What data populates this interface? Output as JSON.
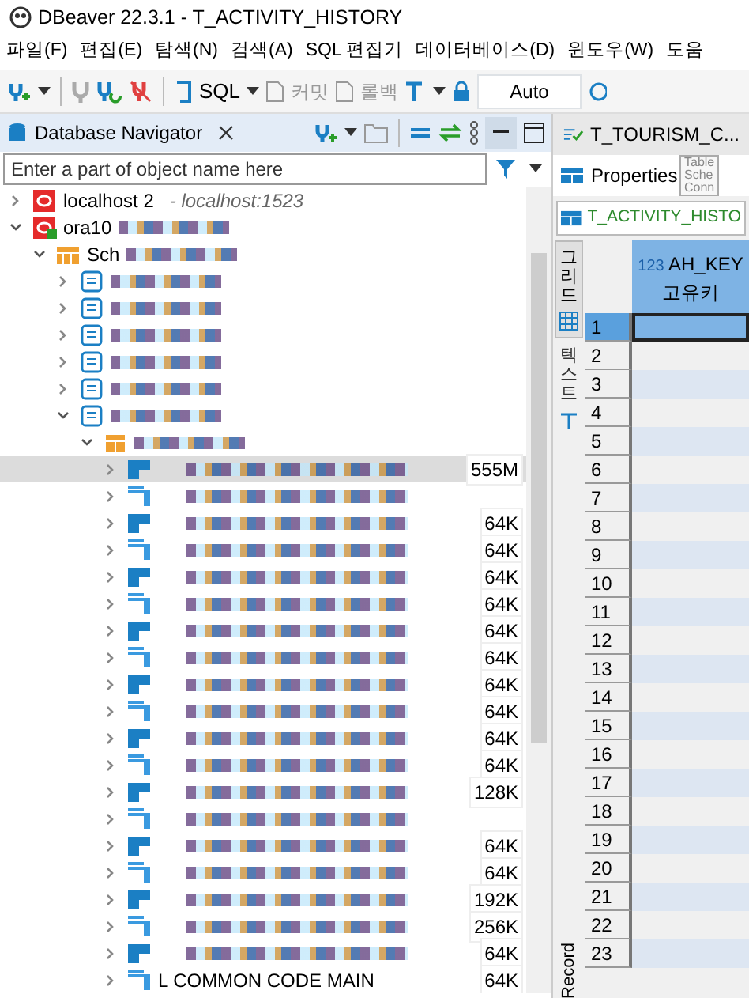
{
  "window": {
    "title": "DBeaver 22.3.1 - T_ACTIVITY_HISTORY"
  },
  "menu": [
    "파일(F)",
    "편집(E)",
    "탐색(N)",
    "검색(A)",
    "SQL 편집기",
    "데이터베이스(D)",
    "윈도우(W)",
    "도움"
  ],
  "toolbar": {
    "sql": "SQL",
    "commit": {
      "label": "커밋",
      "disabled": true
    },
    "rollback": {
      "label": "롤백",
      "disabled": true
    },
    "mode": "Auto"
  },
  "navigator": {
    "title": "Database Navigator",
    "filter": {
      "placeholder": "Enter a part of object name here"
    },
    "tree": [
      {
        "kind": "connection",
        "label": "localhost 2",
        "detail": "- localhost:1523",
        "expanded": false,
        "connected": false
      },
      {
        "kind": "connection",
        "label": "ora10",
        "obscured": true,
        "expanded": true,
        "connected": true,
        "children": [
          {
            "kind": "schemas",
            "label": "Sch",
            "obscured": true,
            "expanded": true,
            "children": [
              {
                "kind": "schema",
                "obscured": true,
                "expanded": false
              },
              {
                "kind": "schema",
                "obscured": true,
                "expanded": false
              },
              {
                "kind": "schema",
                "obscured": true,
                "expanded": false
              },
              {
                "kind": "schema",
                "obscured": true,
                "expanded": false
              },
              {
                "kind": "schema",
                "obscured": true,
                "expanded": false
              },
              {
                "kind": "schema",
                "obscured": true,
                "expanded": true,
                "children": [
                  {
                    "kind": "folder",
                    "obscured": true,
                    "expanded": true,
                    "children": [
                      {
                        "kind": "table",
                        "obscured": true,
                        "size": "555M",
                        "selected": true
                      },
                      {
                        "kind": "view",
                        "obscured": true,
                        "selected": false
                      },
                      {
                        "kind": "table",
                        "obscured": true,
                        "size": "64K",
                        "selected": false
                      },
                      {
                        "kind": "view",
                        "obscured": true,
                        "size": "64K",
                        "selected": false
                      },
                      {
                        "kind": "table",
                        "obscured": true,
                        "size": "64K",
                        "selected": false
                      },
                      {
                        "kind": "view",
                        "obscured": true,
                        "size": "64K",
                        "selected": false
                      },
                      {
                        "kind": "table",
                        "obscured": true,
                        "size": "64K",
                        "selected": false
                      },
                      {
                        "kind": "view",
                        "obscured": true,
                        "size": "64K",
                        "selected": false
                      },
                      {
                        "kind": "table",
                        "obscured": true,
                        "size": "64K",
                        "selected": false
                      },
                      {
                        "kind": "view",
                        "obscured": true,
                        "size": "64K",
                        "selected": false
                      },
                      {
                        "kind": "table",
                        "obscured": true,
                        "size": "64K",
                        "selected": false
                      },
                      {
                        "kind": "view",
                        "obscured": true,
                        "size": "64K",
                        "selected": false
                      },
                      {
                        "kind": "table",
                        "obscured": true,
                        "size": "128K",
                        "selected": false
                      },
                      {
                        "kind": "view",
                        "obscured": true,
                        "selected": false
                      },
                      {
                        "kind": "table",
                        "obscured": true,
                        "size": "64K",
                        "selected": false
                      },
                      {
                        "kind": "view",
                        "obscured": true,
                        "size": "64K",
                        "selected": false
                      },
                      {
                        "kind": "table",
                        "obscured": true,
                        "size": "192K",
                        "selected": false
                      },
                      {
                        "kind": "view",
                        "obscured": true,
                        "size": "256K",
                        "selected": false
                      },
                      {
                        "kind": "table",
                        "obscured": true,
                        "size": "64K",
                        "selected": false
                      },
                      {
                        "kind": "view",
                        "label": "L COMMON CODE MAIN",
                        "size": "64K",
                        "selected": false
                      }
                    ]
                  }
                ]
              }
            ]
          }
        ]
      }
    ]
  },
  "editor": {
    "tab": "T_TOURISM_C...",
    "subtab": "Properties",
    "tooltip": [
      "Table",
      "Sche",
      "Conn"
    ],
    "breadcrumb": "T_ACTIVITY_HISTO",
    "side_tabs": [
      {
        "label": "그리드",
        "selected": true
      },
      {
        "label": "텍스트",
        "selected": false
      }
    ],
    "record": "Record",
    "grid": {
      "column": {
        "type": "123",
        "name": "AH_KEY",
        "comment": "고유키"
      },
      "rows": [
        {
          "num": "1",
          "selected": true
        },
        {
          "num": "2",
          "selected": false
        },
        {
          "num": "3",
          "selected": false
        },
        {
          "num": "4",
          "selected": false
        },
        {
          "num": "5",
          "selected": false
        },
        {
          "num": "6",
          "selected": false
        },
        {
          "num": "7",
          "selected": false
        },
        {
          "num": "8",
          "selected": false
        },
        {
          "num": "9",
          "selected": false
        },
        {
          "num": "10",
          "selected": false
        },
        {
          "num": "11",
          "selected": false
        },
        {
          "num": "12",
          "selected": false
        },
        {
          "num": "13",
          "selected": false
        },
        {
          "num": "14",
          "selected": false
        },
        {
          "num": "15",
          "selected": false
        },
        {
          "num": "16",
          "selected": false
        },
        {
          "num": "17",
          "selected": false
        },
        {
          "num": "18",
          "selected": false
        },
        {
          "num": "19",
          "selected": false
        },
        {
          "num": "20",
          "selected": false
        },
        {
          "num": "21",
          "selected": false
        },
        {
          "num": "22",
          "selected": false
        },
        {
          "num": "23",
          "selected": false
        }
      ]
    }
  }
}
